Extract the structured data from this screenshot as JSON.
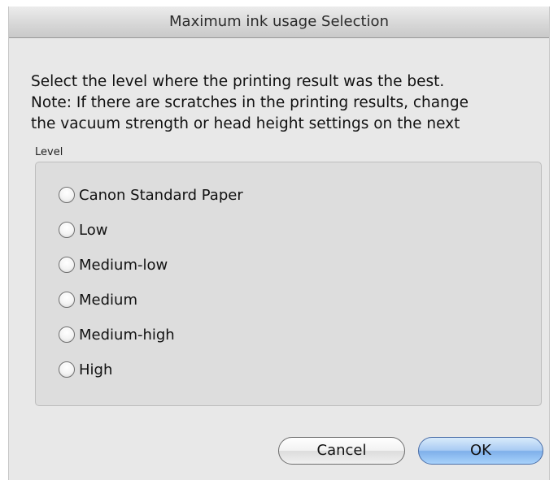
{
  "dialog": {
    "title": "Maximum ink usage Selection",
    "instructions": [
      "Select the level where the printing result was the best.",
      "Note: If there are scratches in the printing results, change",
      "the vacuum strength or head height settings on the next"
    ],
    "group_label": "Level",
    "options": [
      {
        "label": "Canon Standard Paper",
        "selected": false
      },
      {
        "label": "Low",
        "selected": false
      },
      {
        "label": "Medium-low",
        "selected": false
      },
      {
        "label": "Medium",
        "selected": false
      },
      {
        "label": "Medium-high",
        "selected": false
      },
      {
        "label": "High",
        "selected": false
      }
    ],
    "buttons": {
      "cancel_label": "Cancel",
      "ok_label": "OK"
    }
  },
  "colors": {
    "window_background": "#e8e8e8",
    "group_background": "#dddddd",
    "default_button_blue": "#7fb0ea"
  }
}
